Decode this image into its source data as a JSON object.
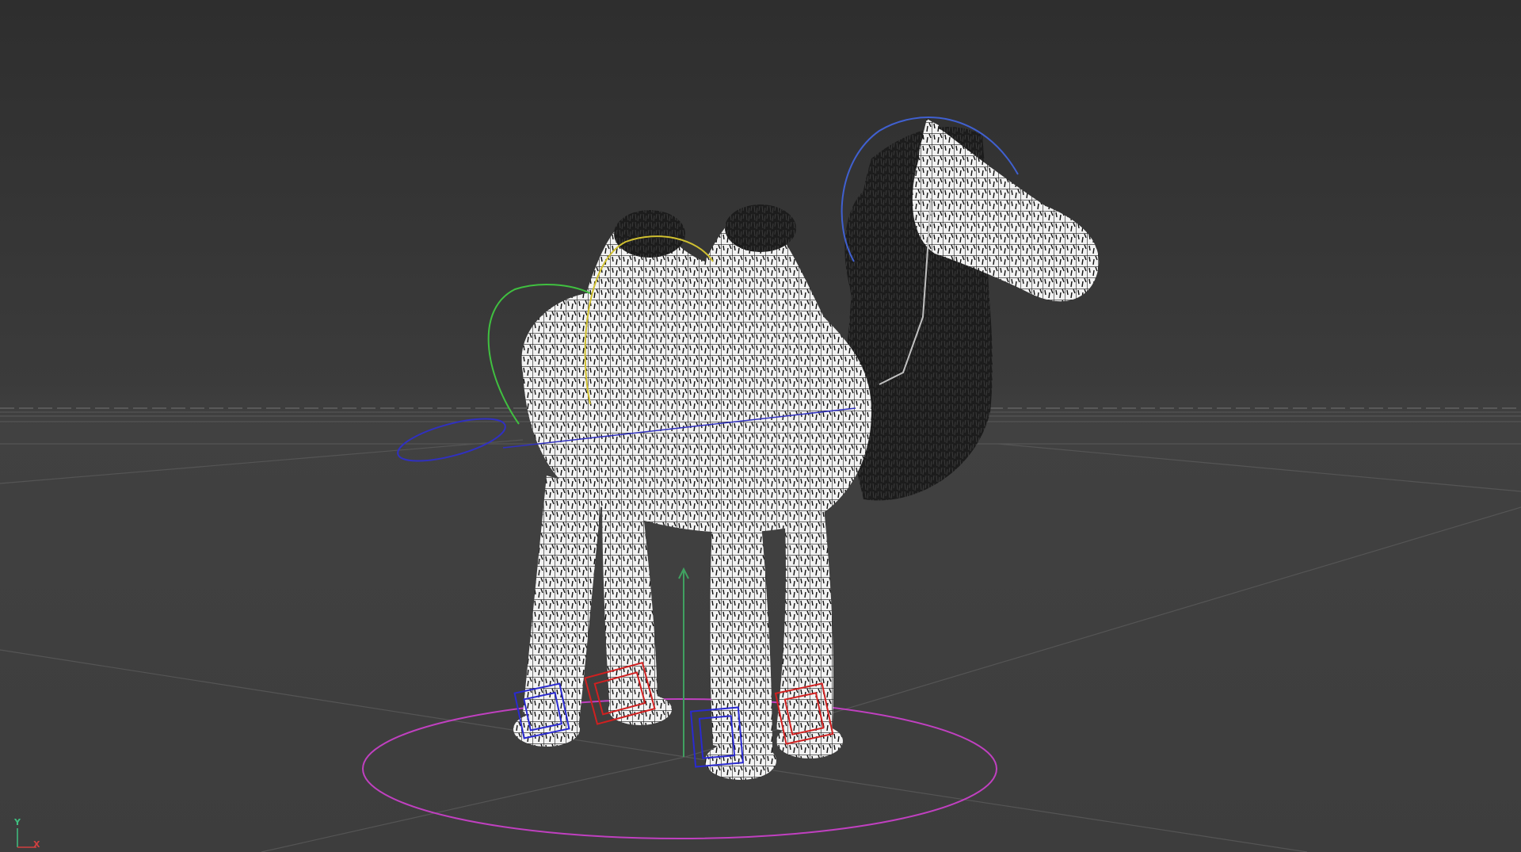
{
  "viewport": {
    "background_top": "#2e2e2e",
    "background_bottom": "#3d3d3d",
    "grid_color": "#5a5a5a",
    "horizon_color": "#6a6a6a"
  },
  "scene": {
    "object": "camel",
    "render_style": "wireframe with fur",
    "rig_controls": {
      "root_circle_color": "#c040c0",
      "foot_control_left_color": "#2a2ad0",
      "foot_control_right_color": "#d02020",
      "spine_control_color": "#d0c030",
      "hip_control_color": "#40c040",
      "tail_control_color": "#3030c0",
      "head_control_color": "#4060d0",
      "up_arrow_color": "#40a060"
    }
  },
  "axis_indicator": {
    "y_label": "Y",
    "x_label": "X",
    "y_color": "#40c080",
    "x_color": "#d04040"
  }
}
